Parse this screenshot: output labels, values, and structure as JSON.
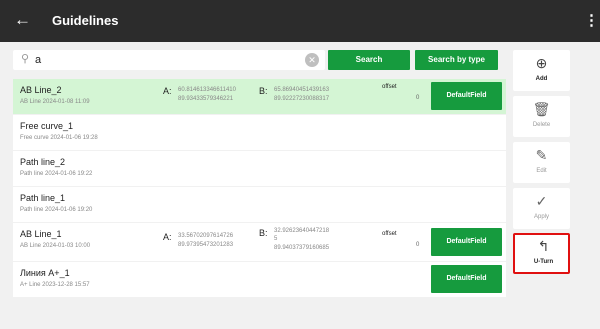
{
  "header": {
    "title": "Guidelines",
    "back_glyph": "←",
    "more_glyph": "⋮"
  },
  "search": {
    "value": "a",
    "placeholder": "",
    "search_label": "Search",
    "search_by_type_label": "Search by type"
  },
  "guidelines": [
    {
      "name": "AB Line_2",
      "subtitle": "AB Line 2024-01-08 11:09",
      "selected": true,
      "a_label": "A:",
      "a_line1": "60.814613346611410",
      "a_line2": "89.93433579346221",
      "b_label": "B:",
      "b_line1": "65.86940451439163",
      "b_line2": "89.92227230088317",
      "b_line3": "",
      "offset_label": "offset",
      "offset_value": "0",
      "field_label": "DefaultField"
    },
    {
      "name": "Free curve_1",
      "subtitle": "Free curve 2024-01-06 19:28",
      "selected": false
    },
    {
      "name": "Path line_2",
      "subtitle": "Path line 2024-01-06 19:22",
      "selected": false
    },
    {
      "name": "Path line_1",
      "subtitle": "Path line 2024-01-06 19:20",
      "selected": false
    },
    {
      "name": "AB Line_1",
      "subtitle": "AB Line 2024-01-03 10:00",
      "selected": false,
      "a_label": "A:",
      "a_line1": "33.56702097614726",
      "a_line2": "89.97395473201283",
      "b_label": "B:",
      "b_line1": "32.92623640447218",
      "b_line2": "5",
      "b_line3": "89.94037379160685",
      "offset_label": "offset",
      "offset_value": "0",
      "field_label": "DefaultField"
    },
    {
      "name": "Линия A+_1",
      "subtitle": "A+ Line 2023-12-28 15:57",
      "selected": false,
      "field_label": "DefaultField"
    }
  ],
  "actions": {
    "add": {
      "label": "Add",
      "icon": "plus-circle-icon",
      "glyph": "⊕"
    },
    "delete": {
      "label": "Delete",
      "icon": "trash-icon",
      "glyph": "🗑"
    },
    "edit": {
      "label": "Edit",
      "icon": "edit-icon",
      "glyph": "✎"
    },
    "apply": {
      "label": "Apply",
      "icon": "check-icon",
      "glyph": "✓"
    },
    "uturn": {
      "label": "U-Turn",
      "icon": "u-turn-icon",
      "glyph": "↰"
    }
  },
  "colors": {
    "topbar": "#2c2c2c",
    "accent_green": "#169b3e",
    "selected_row": "#d4f5d4",
    "highlight_border": "#e01010"
  }
}
